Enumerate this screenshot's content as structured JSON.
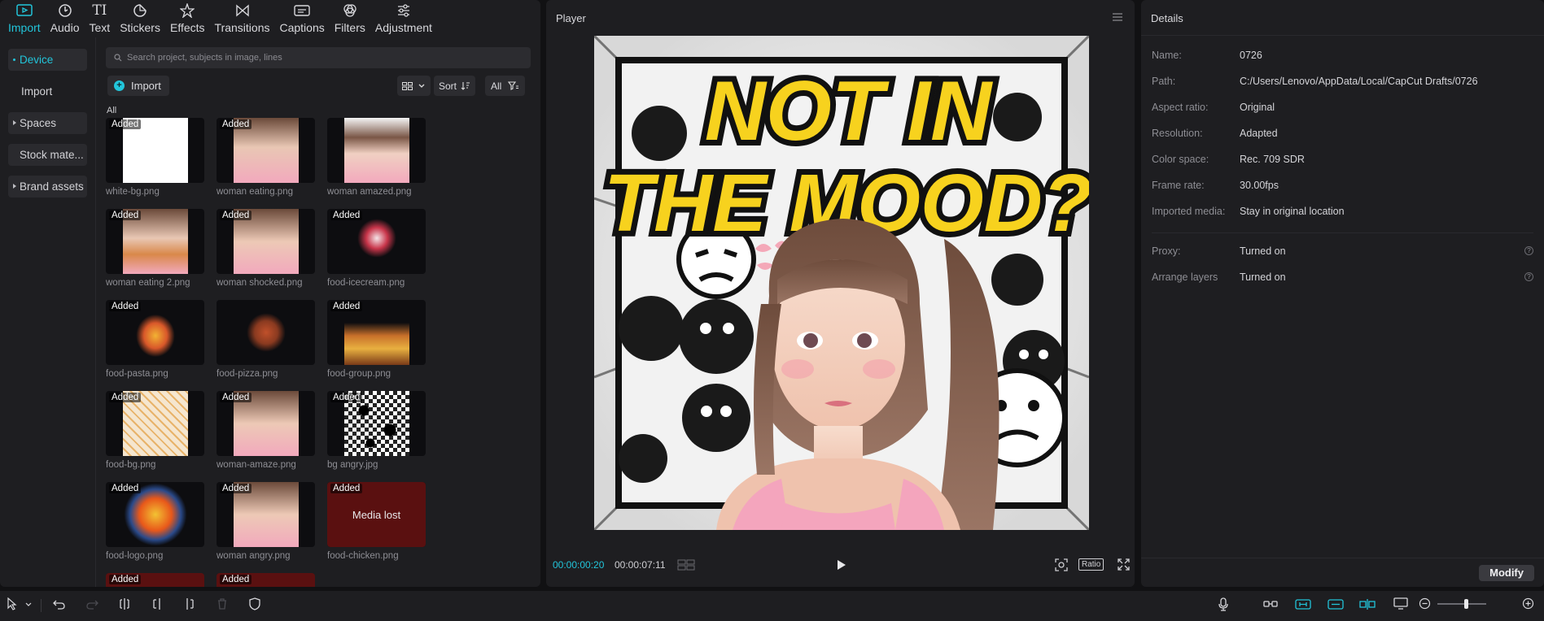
{
  "top_tabs": [
    {
      "label": "Import",
      "icon": "import-icon",
      "active": true
    },
    {
      "label": "Audio",
      "icon": "audio-icon"
    },
    {
      "label": "Text",
      "icon": "text-icon"
    },
    {
      "label": "Stickers",
      "icon": "stickers-icon"
    },
    {
      "label": "Effects",
      "icon": "effects-icon"
    },
    {
      "label": "Transitions",
      "icon": "transitions-icon"
    },
    {
      "label": "Captions",
      "icon": "captions-icon"
    },
    {
      "label": "Filters",
      "icon": "filters-icon"
    },
    {
      "label": "Adjustment",
      "icon": "adjustment-icon"
    }
  ],
  "side_nav": {
    "device": "Device",
    "import": "Import",
    "spaces": "Spaces",
    "stock": "Stock mate...",
    "brand": "Brand assets"
  },
  "search": {
    "placeholder": "Search project, subjects in image, lines"
  },
  "toolbar": {
    "import_label": "Import",
    "sort_label": "Sort",
    "all_label": "All"
  },
  "section_label": "All",
  "badge_text": "Added",
  "media": [
    {
      "name": "white-bg.png"
    },
    {
      "name": "woman eating.png"
    },
    {
      "name": "woman amazed.png"
    },
    {
      "name": "woman eating 2.png"
    },
    {
      "name": "woman shocked.png"
    },
    {
      "name": "food-icecream.png"
    },
    {
      "name": "food-pasta.png"
    },
    {
      "name": "food-pizza.png"
    },
    {
      "name": "food-group.png"
    },
    {
      "name": "food-bg.png"
    },
    {
      "name": "woman-amaze.png"
    },
    {
      "name": "bg angry.jpg"
    },
    {
      "name": "food-logo.png"
    },
    {
      "name": "woman angry.png"
    },
    {
      "name": "food-chicken.png",
      "lost_text": "Media lost"
    }
  ],
  "player": {
    "title": "Player",
    "canvas_text_line1": "NOT IN",
    "canvas_text_line2": "THE MOOD?",
    "time_current": "00:00:00:20",
    "time_total": "00:00:07:11",
    "ratio_label": "Ratio"
  },
  "details": {
    "title": "Details",
    "rows": [
      {
        "key": "Name:",
        "value": "0726"
      },
      {
        "key": "Path:",
        "value": "C:/Users/Lenovo/AppData/Local/CapCut Drafts/0726"
      },
      {
        "key": "Aspect ratio:",
        "value": "Original"
      },
      {
        "key": "Resolution:",
        "value": "Adapted"
      },
      {
        "key": "Color space:",
        "value": "Rec. 709 SDR"
      },
      {
        "key": "Frame rate:",
        "value": "30.00fps"
      },
      {
        "key": "Imported media:",
        "value": "Stay in original location"
      }
    ],
    "extra_rows": [
      {
        "key": "Proxy:",
        "value": "Turned on"
      },
      {
        "key": "Arrange layers",
        "value": "Turned on"
      }
    ],
    "modify_label": "Modify"
  },
  "colors": {
    "accent": "#22c5da",
    "panel": "#1e1e21",
    "background": "#111113",
    "lost": "#5a1010"
  }
}
